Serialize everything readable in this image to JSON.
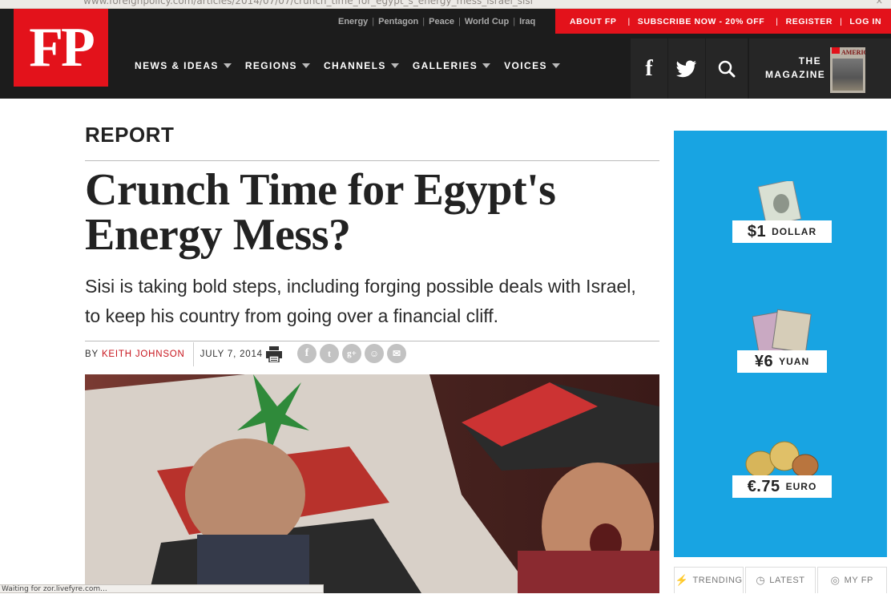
{
  "browser": {
    "url": "www.foreignpolicy.com/articles/2014/07/07/crunch_time_for_egypt_s_energy_mess_israel_sisi",
    "status_text": "Waiting for zor.livefyre.com..."
  },
  "header": {
    "logo_text": "FP",
    "utility_links": [
      "Energy",
      "Pentagon",
      "Peace",
      "World Cup",
      "Iraq"
    ],
    "red_links": {
      "about": "ABOUT FP",
      "subscribe": "SUBSCRIBE NOW - 20% OFF",
      "register": "REGISTER",
      "login": "LOG IN"
    },
    "nav": [
      "NEWS & IDEAS",
      "REGIONS",
      "CHANNELS",
      "GALLERIES",
      "VOICES"
    ],
    "magazine_line1": "THE",
    "magazine_line2": "MAGAZINE",
    "magazine_cover_title": "AMERICA"
  },
  "article": {
    "section": "REPORT",
    "title_line1": "Crunch Time for Egypt's",
    "title_line2": "Energy Mess?",
    "dek": "Sisi is taking bold steps, including forging possible deals with Israel, to keep his country from going over a financial cliff.",
    "by": "BY",
    "author": "KEITH JOHNSON",
    "date": "JULY 7, 2014",
    "share_icons": [
      "facebook-icon",
      "twitter-icon",
      "googleplus-icon",
      "reddit-icon",
      "email-icon"
    ]
  },
  "ad": {
    "items": [
      {
        "amount": "$1",
        "unit": "DOLLAR"
      },
      {
        "amount": "¥6",
        "unit": "YUAN"
      },
      {
        "amount": "€.75",
        "unit": "EURO"
      }
    ]
  },
  "tabs": [
    {
      "label": "TRENDING",
      "icon": "bolt-icon"
    },
    {
      "label": "LATEST",
      "icon": "clock-icon"
    },
    {
      "label": "MY FP",
      "icon": "fingerprint-icon"
    }
  ],
  "colors": {
    "brand_red": "#e3121b",
    "header_bg": "#1c1c1c",
    "ad_blue": "#18a4e2"
  }
}
